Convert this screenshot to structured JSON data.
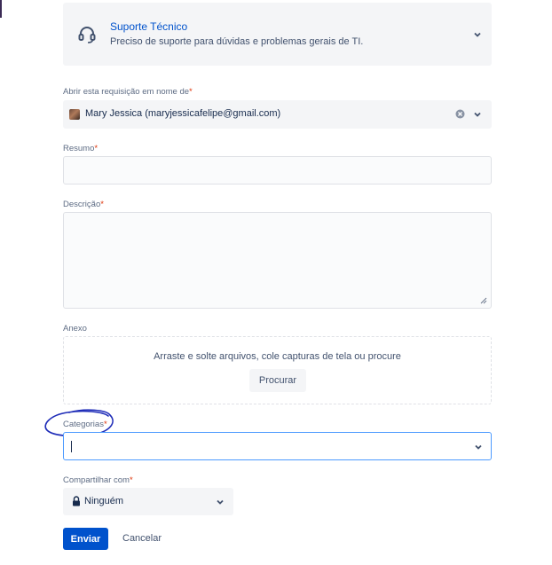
{
  "request_type": {
    "title": "Suporte Técnico",
    "description": "Preciso de suporte para dúvidas e problemas gerais de TI."
  },
  "on_behalf": {
    "label": "Abrir esta requisição em nome de",
    "required_mark": "*",
    "value": "Mary Jessica (maryjessicafelipe@gmail.com)"
  },
  "summary": {
    "label": "Resumo",
    "required_mark": "*",
    "value": ""
  },
  "description": {
    "label": "Descrição",
    "required_mark": "*",
    "value": ""
  },
  "attachment": {
    "label": "Anexo",
    "dropzone_text": "Arraste e solte arquivos, cole capturas de tela ou procure",
    "browse_label": "Procurar"
  },
  "categories": {
    "label": "Categorias",
    "required_mark": "*",
    "value": ""
  },
  "share": {
    "label": "Compartilhar com",
    "required_mark": "*",
    "value": "Ninguém"
  },
  "actions": {
    "submit_label": "Enviar",
    "cancel_label": "Cancelar"
  },
  "colors": {
    "primary": "#0052cc",
    "required": "#de350b",
    "focus_border": "#4c9aff",
    "annotation": "#1f2db8"
  }
}
